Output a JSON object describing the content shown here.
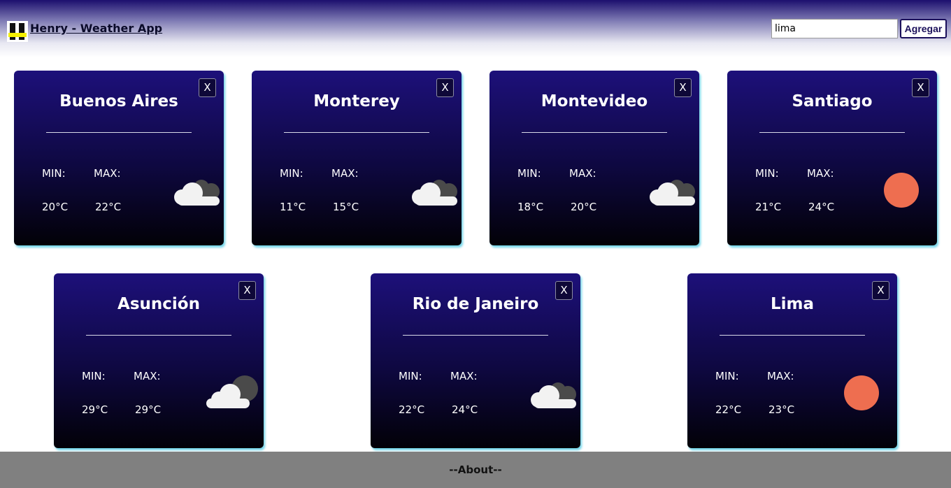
{
  "header": {
    "app_title": "Henry - Weather App",
    "search": {
      "value": "lima",
      "placeholder": ""
    },
    "add_label": "Agregar"
  },
  "labels": {
    "min": "MIN:",
    "max": "MAX:",
    "close": "X"
  },
  "cards": [
    {
      "city": "Buenos Aires",
      "min": "20°C",
      "max": "22°C",
      "icon": "cloudy-icon"
    },
    {
      "city": "Monterey",
      "min": "11°C",
      "max": "15°C",
      "icon": "cloudy-icon"
    },
    {
      "city": "Montevideo",
      "min": "18°C",
      "max": "20°C",
      "icon": "cloudy-icon"
    },
    {
      "city": "Santiago",
      "min": "21°C",
      "max": "24°C",
      "icon": "sun-icon"
    },
    {
      "city": "Asunción",
      "min": "29°C",
      "max": "29°C",
      "icon": "partly-cloudy-icon"
    },
    {
      "city": "Rio de Janeiro",
      "min": "22°C",
      "max": "24°C",
      "icon": "cloudy-icon"
    },
    {
      "city": "Lima",
      "min": "22°C",
      "max": "23°C",
      "icon": "sun-icon"
    }
  ],
  "colors": {
    "sun": "#ee6e50",
    "cloud_front": "#f2f2f2",
    "cloud_back": "#4a4a4a",
    "card_top": "#1d107a",
    "card_bottom": "#020107",
    "card_glow": "#6fd4e8",
    "footer": "#808080"
  },
  "footer": {
    "about_label": "--About--"
  }
}
